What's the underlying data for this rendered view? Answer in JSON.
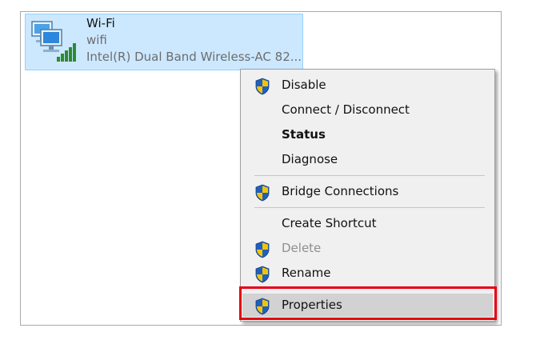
{
  "adapter": {
    "name": "Wi-Fi",
    "network": "wifi",
    "device": "Intel(R) Dual Band Wireless-AC 82...",
    "icon": "network-adapter-icon",
    "signal_icon": "signal-bars-icon"
  },
  "context_menu": {
    "items": [
      {
        "label": "Disable",
        "shield": true
      },
      {
        "label": "Connect / Disconnect",
        "shield": false
      },
      {
        "label": "Status",
        "shield": false,
        "bold": true
      },
      {
        "label": "Diagnose",
        "shield": false
      },
      {
        "label": "Bridge Connections",
        "shield": true
      },
      {
        "label": "Create Shortcut",
        "shield": false
      },
      {
        "label": "Delete",
        "shield": true,
        "disabled": true
      },
      {
        "label": "Rename",
        "shield": true
      },
      {
        "label": "Properties",
        "shield": true,
        "highlighted": true
      }
    ]
  },
  "colors": {
    "selection_fill": "#cce8ff",
    "highlight_border": "#e60012",
    "shield_blue": "#1f5fbf",
    "shield_yellow": "#f5c400"
  }
}
